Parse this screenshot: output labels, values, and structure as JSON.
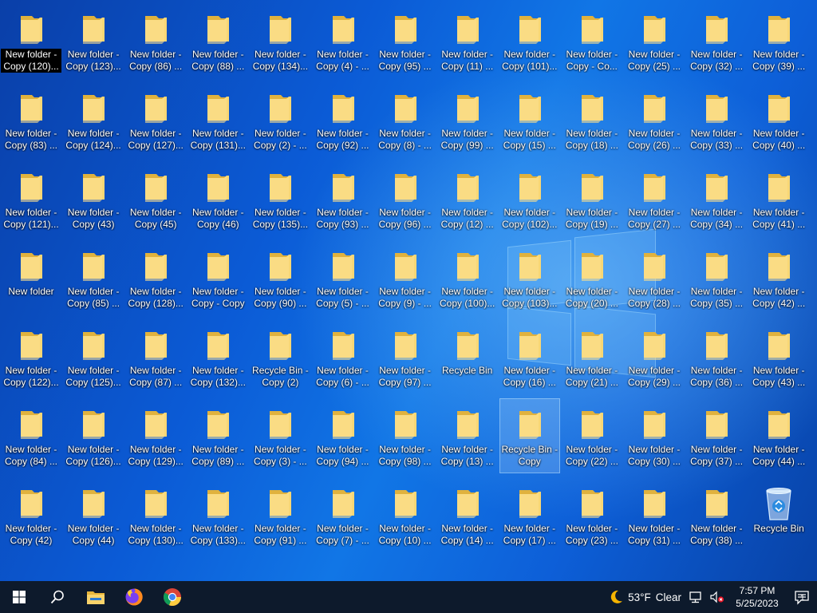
{
  "desktop": {
    "icons": [
      {
        "label": "New folder -\nCopy (120)...",
        "type": "folder",
        "selected": false,
        "focused": true
      },
      {
        "label": "New folder -\nCopy (123)...",
        "type": "folder"
      },
      {
        "label": "New folder -\nCopy (86) ...",
        "type": "folder"
      },
      {
        "label": "New folder -\nCopy (88) ...",
        "type": "folder"
      },
      {
        "label": "New folder -\nCopy (134)...",
        "type": "folder"
      },
      {
        "label": "New folder -\nCopy (4) - ...",
        "type": "folder"
      },
      {
        "label": "New folder -\nCopy (95) ...",
        "type": "folder"
      },
      {
        "label": "New folder -\nCopy (11) ...",
        "type": "folder"
      },
      {
        "label": "New folder -\nCopy (101)...",
        "type": "folder"
      },
      {
        "label": "New folder -\nCopy - Co...",
        "type": "folder"
      },
      {
        "label": "New folder -\nCopy (25) ...",
        "type": "folder"
      },
      {
        "label": "New folder -\nCopy (32) ...",
        "type": "folder"
      },
      {
        "label": "New folder -\nCopy (39) ...",
        "type": "folder"
      },
      {
        "label": "New folder -\nCopy (83) ...",
        "type": "folder"
      },
      {
        "label": "New folder -\nCopy (124)...",
        "type": "folder"
      },
      {
        "label": "New folder -\nCopy (127)...",
        "type": "folder"
      },
      {
        "label": "New folder -\nCopy (131)...",
        "type": "folder"
      },
      {
        "label": "New folder -\nCopy (2) - ...",
        "type": "folder"
      },
      {
        "label": "New folder -\nCopy (92) ...",
        "type": "folder"
      },
      {
        "label": "New folder -\nCopy (8) - ...",
        "type": "folder"
      },
      {
        "label": "New folder -\nCopy (99) ...",
        "type": "folder"
      },
      {
        "label": "New folder -\nCopy (15) ...",
        "type": "folder"
      },
      {
        "label": "New folder -\nCopy (18) ...",
        "type": "folder"
      },
      {
        "label": "New folder -\nCopy (26) ...",
        "type": "folder"
      },
      {
        "label": "New folder -\nCopy (33) ...",
        "type": "folder"
      },
      {
        "label": "New folder -\nCopy (40) ...",
        "type": "folder"
      },
      {
        "label": "New folder -\nCopy (121)...",
        "type": "folder"
      },
      {
        "label": "New folder -\nCopy (43)",
        "type": "folder"
      },
      {
        "label": "New folder -\nCopy (45)",
        "type": "folder"
      },
      {
        "label": "New folder -\nCopy (46)",
        "type": "folder"
      },
      {
        "label": "New folder -\nCopy (135)...",
        "type": "folder"
      },
      {
        "label": "New folder -\nCopy (93) ...",
        "type": "folder"
      },
      {
        "label": "New folder -\nCopy (96) ...",
        "type": "folder"
      },
      {
        "label": "New folder -\nCopy (12) ...",
        "type": "folder"
      },
      {
        "label": "New folder -\nCopy (102)...",
        "type": "folder"
      },
      {
        "label": "New folder -\nCopy (19) ...",
        "type": "folder"
      },
      {
        "label": "New folder -\nCopy (27) ...",
        "type": "folder"
      },
      {
        "label": "New folder -\nCopy (34) ...",
        "type": "folder"
      },
      {
        "label": "New folder -\nCopy (41) ...",
        "type": "folder"
      },
      {
        "label": "New folder",
        "type": "folder"
      },
      {
        "label": "New folder -\nCopy (85) ...",
        "type": "folder"
      },
      {
        "label": "New folder -\nCopy (128)...",
        "type": "folder"
      },
      {
        "label": "New folder -\nCopy - Copy",
        "type": "folder"
      },
      {
        "label": "New folder -\nCopy (90) ...",
        "type": "folder"
      },
      {
        "label": "New folder -\nCopy (5) - ...",
        "type": "folder"
      },
      {
        "label": "New folder -\nCopy (9) - ...",
        "type": "folder"
      },
      {
        "label": "New folder -\nCopy (100)...",
        "type": "folder"
      },
      {
        "label": "New folder -\nCopy (103)...",
        "type": "folder"
      },
      {
        "label": "New folder -\nCopy (20) ...",
        "type": "folder"
      },
      {
        "label": "New folder -\nCopy (28) ...",
        "type": "folder"
      },
      {
        "label": "New folder -\nCopy (35) ...",
        "type": "folder"
      },
      {
        "label": "New folder -\nCopy (42) ...",
        "type": "folder"
      },
      {
        "label": "New folder -\nCopy (122)...",
        "type": "folder"
      },
      {
        "label": "New folder -\nCopy (125)...",
        "type": "folder"
      },
      {
        "label": "New folder -\nCopy (87) ...",
        "type": "folder"
      },
      {
        "label": "New folder -\nCopy (132)...",
        "type": "folder"
      },
      {
        "label": "Recycle Bin -\nCopy (2)",
        "type": "folder"
      },
      {
        "label": "New folder -\nCopy (6) - ...",
        "type": "folder"
      },
      {
        "label": "New folder -\nCopy (97) ...",
        "type": "folder"
      },
      {
        "label": "Recycle Bin",
        "type": "folder"
      },
      {
        "label": "New folder -\nCopy (16) ...",
        "type": "folder"
      },
      {
        "label": "New folder -\nCopy (21) ...",
        "type": "folder"
      },
      {
        "label": "New folder -\nCopy (29) ...",
        "type": "folder"
      },
      {
        "label": "New folder -\nCopy (36) ...",
        "type": "folder"
      },
      {
        "label": "New folder -\nCopy (43) ...",
        "type": "folder"
      },
      {
        "label": "New folder -\nCopy (84) ...",
        "type": "folder"
      },
      {
        "label": "New folder -\nCopy (126)...",
        "type": "folder"
      },
      {
        "label": "New folder -\nCopy (129)...",
        "type": "folder"
      },
      {
        "label": "New folder -\nCopy (89) ...",
        "type": "folder"
      },
      {
        "label": "New folder -\nCopy (3) - ...",
        "type": "folder"
      },
      {
        "label": "New folder -\nCopy (94) ...",
        "type": "folder"
      },
      {
        "label": "New folder -\nCopy (98) ...",
        "type": "folder"
      },
      {
        "label": "New folder -\nCopy (13) ...",
        "type": "folder"
      },
      {
        "label": "Recycle Bin -\nCopy",
        "type": "folder",
        "selected": true
      },
      {
        "label": "New folder -\nCopy (22) ...",
        "type": "folder"
      },
      {
        "label": "New folder -\nCopy (30) ...",
        "type": "folder"
      },
      {
        "label": "New folder -\nCopy (37) ...",
        "type": "folder"
      },
      {
        "label": "New folder -\nCopy (44) ...",
        "type": "folder"
      },
      {
        "label": "New folder -\nCopy (42)",
        "type": "folder"
      },
      {
        "label": "New folder -\nCopy (44)",
        "type": "folder"
      },
      {
        "label": "New folder -\nCopy (130)...",
        "type": "folder"
      },
      {
        "label": "New folder -\nCopy (133)...",
        "type": "folder"
      },
      {
        "label": "New folder -\nCopy (91) ...",
        "type": "folder"
      },
      {
        "label": "New folder -\nCopy (7) - ...",
        "type": "folder"
      },
      {
        "label": "New folder -\nCopy (10) ...",
        "type": "folder"
      },
      {
        "label": "New folder -\nCopy (14) ...",
        "type": "folder"
      },
      {
        "label": "New folder -\nCopy (17) ...",
        "type": "folder"
      },
      {
        "label": "New folder -\nCopy (23) ...",
        "type": "folder"
      },
      {
        "label": "New folder -\nCopy (31) ...",
        "type": "folder"
      },
      {
        "label": "New folder -\nCopy (38) ...",
        "type": "folder"
      },
      {
        "label": "Recycle Bin",
        "type": "recycle-bin"
      }
    ]
  },
  "taskbar": {
    "start_icon": "windows-logo-icon",
    "search_icon": "search-icon",
    "pinned": [
      {
        "name": "file-explorer",
        "icon": "file-explorer-icon"
      },
      {
        "name": "firefox",
        "icon": "firefox-icon"
      },
      {
        "name": "chrome",
        "icon": "chrome-icon"
      }
    ],
    "weather": {
      "temp": "53°F",
      "desc": "Clear",
      "icon": "moon-icon"
    },
    "clock": {
      "time": "7:57 PM",
      "date": "5/25/2023"
    },
    "notifications": {
      "count": "1"
    }
  },
  "colors": {
    "folder_front": "#f8d775",
    "folder_back": "#e0b23e",
    "taskbar": "#0d1a2c"
  }
}
